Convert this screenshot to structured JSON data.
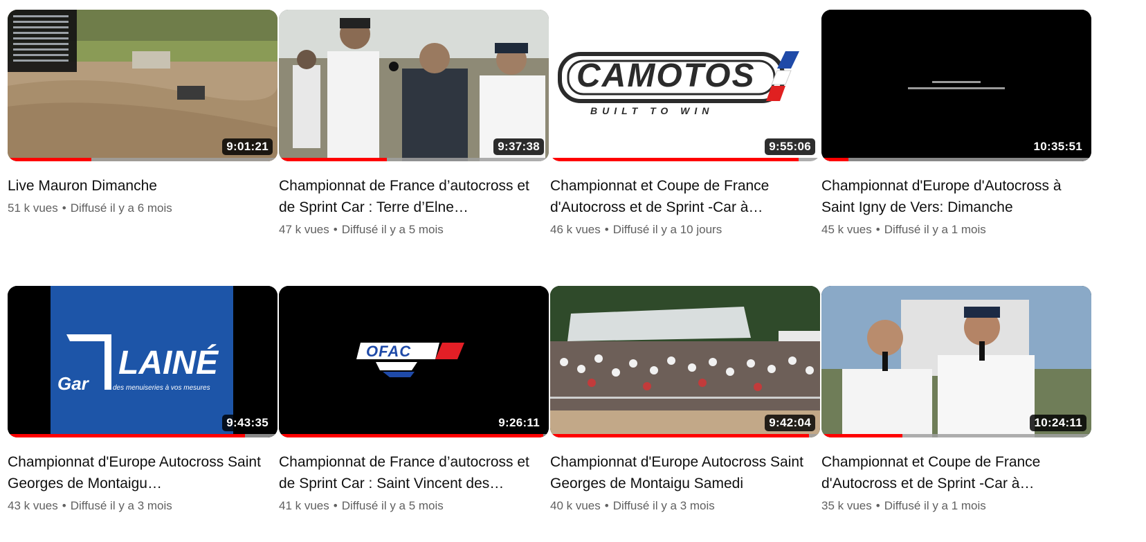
{
  "videos": [
    {
      "title": "Live Mauron Dimanche",
      "views": "51 k vues",
      "age": "Diffusé il y a 6 mois",
      "duration": "9:01:21",
      "progress": 0.31,
      "thumb": "rally-track-icon"
    },
    {
      "title": "Championnat de France d’autocross et de Sprint Car : Terre d’Elne…",
      "views": "47 k vues",
      "age": "Diffusé il y a 5 mois",
      "duration": "9:37:38",
      "progress": 0.4,
      "thumb": "interview-icon"
    },
    {
      "title": "Championnat et Coupe de France d'Autocross et de Sprint -Car à…",
      "views": "46 k vues",
      "age": "Diffusé il y a 10 jours",
      "duration": "9:55:06",
      "progress": 0.92,
      "thumb": "camotos-logo-icon"
    },
    {
      "title": "Championnat d'Europe d'Autocross à Saint Igny de Vers: Dimanche",
      "views": "45 k vues",
      "age": "Diffusé il y a 1 mois",
      "duration": "10:35:51",
      "progress": 0.1,
      "thumb": "credits-screen-icon"
    },
    {
      "title": "Championnat d'Europe Autocross Saint Georges de Montaigu…",
      "views": "43 k vues",
      "age": "Diffusé il y a 3 mois",
      "duration": "9:43:35",
      "progress": 0.88,
      "thumb": "laine-logo-icon"
    },
    {
      "title": "Championnat de France d’autocross et de Sprint Car : Saint Vincent des…",
      "views": "41 k vues",
      "age": "Diffusé il y a 5 mois",
      "duration": "9:26:11",
      "progress": 0.98,
      "thumb": "ofac-logo-icon"
    },
    {
      "title": "Championnat d'Europe Autocross Saint Georges de Montaigu Samedi",
      "views": "40 k vues",
      "age": "Diffusé il y a 3 mois",
      "duration": "9:42:04",
      "progress": 0.96,
      "thumb": "crowd-scene-icon"
    },
    {
      "title": "Championnat et Coupe de France d'Autocross et de Sprint -Car à…",
      "views": "35 k vues",
      "age": "Diffusé il y a 1 mois",
      "duration": "10:24:11",
      "progress": 0.3,
      "thumb": "presenters-icon"
    }
  ],
  "logos": {
    "camotos": "CAMOTOS",
    "camotos_tagline": "BUILT TO WIN",
    "laine": "LAINÉ",
    "laine_prefix": "Gar",
    "laine_tagline": "des menuiseries à vos mesures",
    "ofac": "OFAC"
  },
  "colors": {
    "accent": "#ff0000",
    "meta": "#606060"
  }
}
